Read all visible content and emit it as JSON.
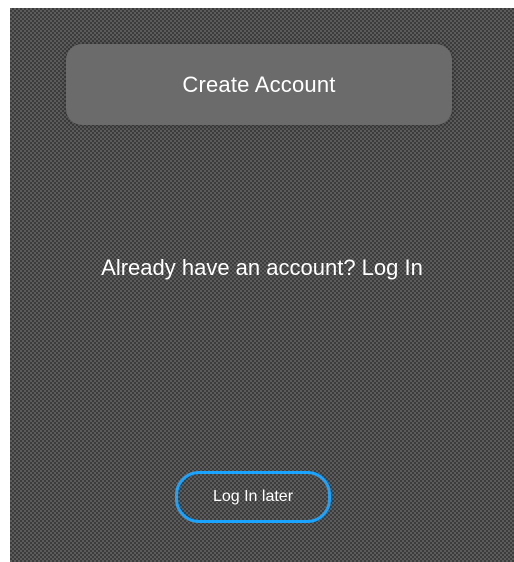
{
  "screen": {
    "create_account_label": "Create Account",
    "login_prompt": "Already have an account? Log In",
    "login_later_label": "Log In later"
  },
  "colors": {
    "focus_ring": "#1aa3ff",
    "text": "#ffffff",
    "button_fill": "#6b6b6b"
  }
}
